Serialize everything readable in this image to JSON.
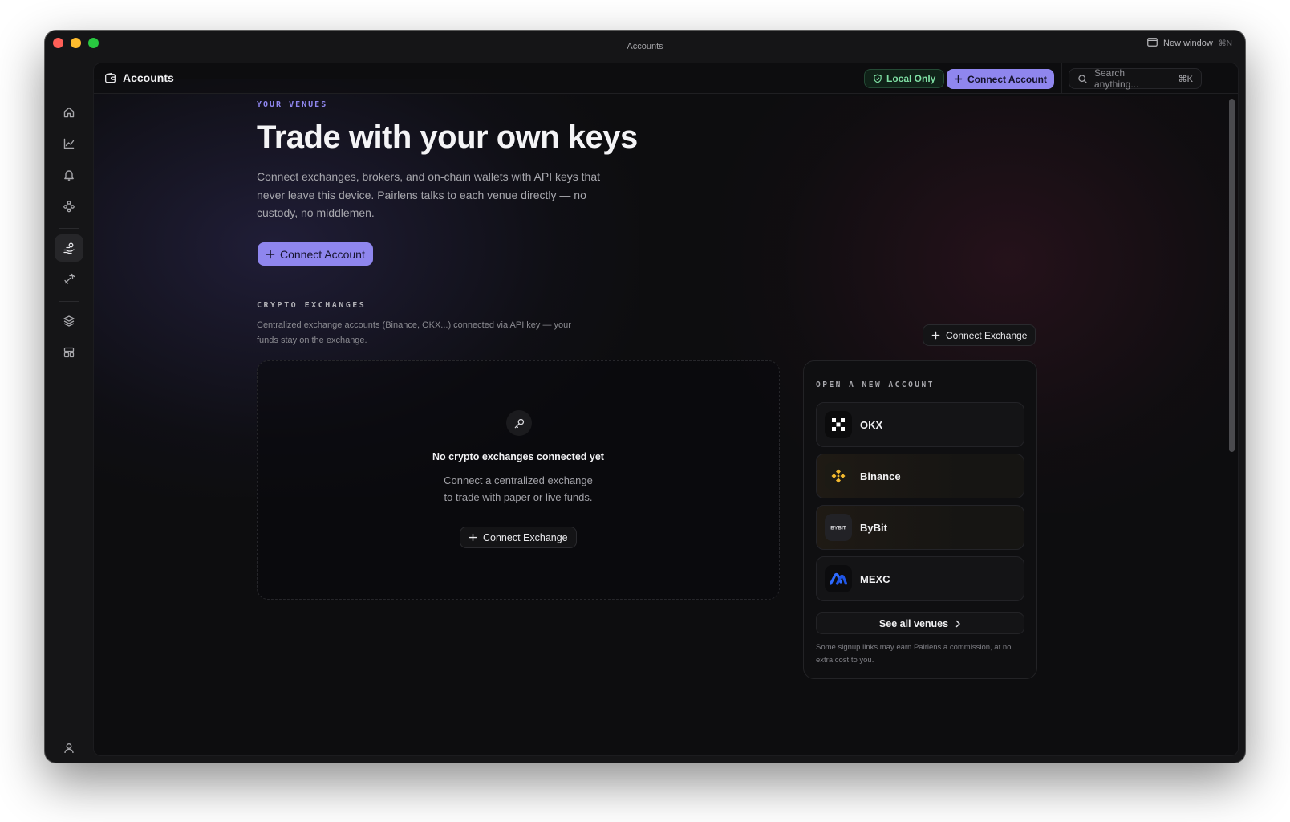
{
  "window": {
    "title": "Accounts",
    "new_window_label": "New window",
    "new_window_shortcut": "⌘N"
  },
  "sidebar": {
    "items": [
      {
        "name": "home",
        "icon": "home-icon"
      },
      {
        "name": "chart",
        "icon": "line-chart-icon"
      },
      {
        "name": "alerts",
        "icon": "bell-icon"
      },
      {
        "name": "flows",
        "icon": "nodes-icon"
      },
      {
        "name": "accounts",
        "icon": "hand-coins-icon",
        "active": true
      },
      {
        "name": "strategies",
        "icon": "rocket-icon"
      },
      {
        "name": "layers",
        "icon": "layers-icon"
      },
      {
        "name": "layout",
        "icon": "layout-icon"
      }
    ],
    "profile_icon": "user-icon"
  },
  "topbar": {
    "title": "Accounts",
    "local_only_label": "Local Only",
    "connect_account_label": "Connect Account",
    "search_placeholder": "Search anything...",
    "search_shortcut": "⌘K"
  },
  "hero": {
    "eyebrow": "YOUR VENUES",
    "title": "Trade with your own keys",
    "description": "Connect exchanges, brokers, and on-chain wallets with API keys that never leave this device. Pairlens talks to each venue directly — no custody, no middlemen.",
    "connect_label": "Connect Account"
  },
  "crypto_section": {
    "eyebrow": "CRYPTO EXCHANGES",
    "description": "Centralized exchange accounts (Binance, OKX...) connected via API key — your funds stay on the exchange.",
    "connect_label": "Connect Exchange",
    "empty_title": "No crypto exchanges connected yet",
    "empty_description_line1": "Connect a centralized exchange",
    "empty_description_line2": "to trade with paper or live funds.",
    "empty_connect_label": "Connect Exchange"
  },
  "new_account_panel": {
    "eyebrow": "OPEN A NEW ACCOUNT",
    "venues": [
      {
        "name": "OKX",
        "logo": "okx-logo"
      },
      {
        "name": "Binance",
        "logo": "binance-logo"
      },
      {
        "name": "ByBit",
        "logo": "bybit-logo"
      },
      {
        "name": "MEXC",
        "logo": "mexc-logo"
      }
    ],
    "see_all_label": "See all venues",
    "note": "Some signup links may earn Pairlens a commission, at no extra cost to you."
  },
  "colors": {
    "accent": "#8f86ee",
    "local_only": "#7fe0a4",
    "binance": "#f3ba2f",
    "mexc": "#2f6bff"
  }
}
